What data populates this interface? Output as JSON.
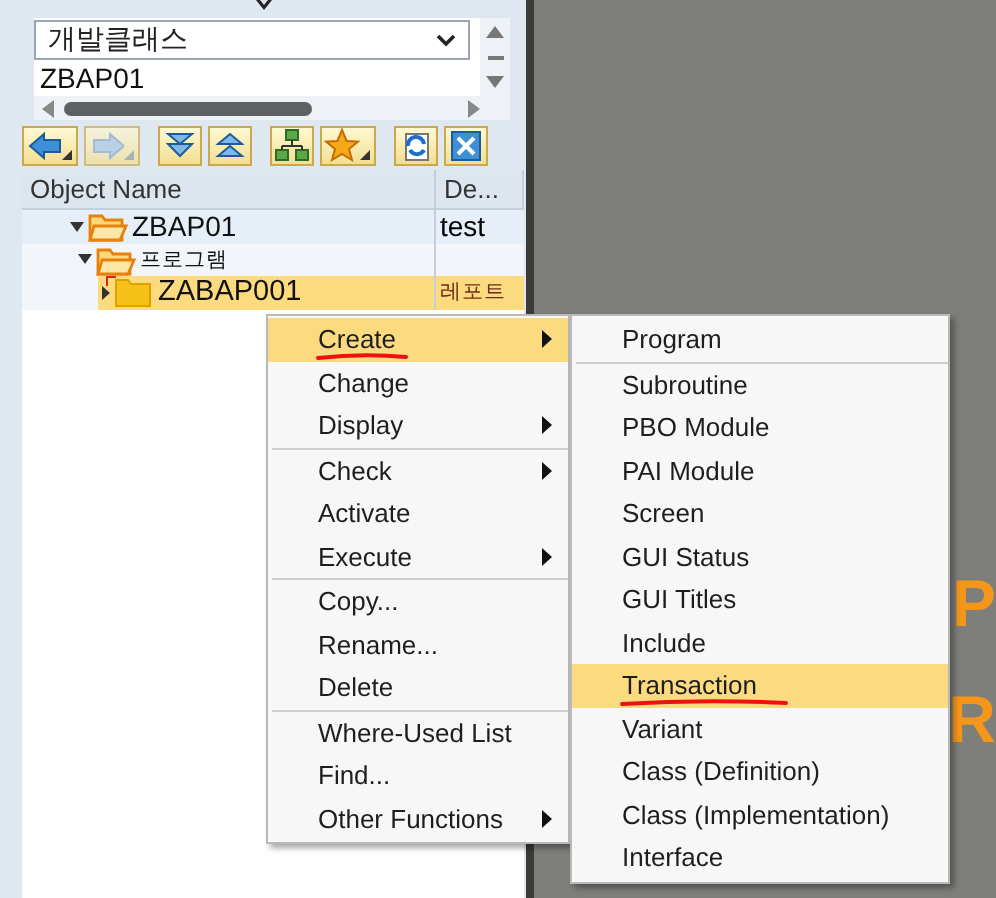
{
  "selector": {
    "value": "개발클래스"
  },
  "object_field": {
    "value": "ZBAP01"
  },
  "toolbar": [
    {
      "kind": "back",
      "dropdown": true,
      "disabled": false
    },
    {
      "kind": "forward",
      "dropdown": true,
      "disabled": true
    },
    {
      "kind": "expand",
      "dropdown": false,
      "disabled": false
    },
    {
      "kind": "collapse",
      "dropdown": false,
      "disabled": false
    },
    {
      "kind": "hierarchy",
      "dropdown": false,
      "disabled": false
    },
    {
      "kind": "favorite",
      "dropdown": true,
      "disabled": false
    },
    {
      "kind": "refresh",
      "dropdown": false,
      "disabled": false
    },
    {
      "kind": "close",
      "dropdown": false,
      "disabled": false
    }
  ],
  "tree": {
    "columns": [
      "Object Name",
      "De..."
    ],
    "rows": [
      {
        "name": "ZBAP01",
        "description": "test",
        "expanded": true,
        "selected": false,
        "children": [
          {
            "name": "프로그램",
            "expanded": true,
            "selected": false,
            "children": [
              {
                "name": "ZABAP001",
                "description": "레포트",
                "expanded": false,
                "selected": true
              }
            ]
          }
        ]
      }
    ]
  },
  "context_menu": {
    "groups": [
      [
        {
          "label": "Create",
          "submenu": true,
          "selected": true,
          "marked": true
        },
        {
          "label": "Change",
          "submenu": false,
          "selected": false,
          "marked": false
        },
        {
          "label": "Display",
          "submenu": true,
          "selected": false,
          "marked": false
        }
      ],
      [
        {
          "label": "Check",
          "submenu": true,
          "selected": false,
          "marked": false
        },
        {
          "label": "Activate",
          "submenu": false,
          "selected": false,
          "marked": false
        },
        {
          "label": "Execute",
          "submenu": true,
          "selected": false,
          "marked": false
        }
      ],
      [
        {
          "label": "Copy...",
          "submenu": false,
          "selected": false,
          "marked": false
        },
        {
          "label": "Rename...",
          "submenu": false,
          "selected": false,
          "marked": false
        },
        {
          "label": "Delete",
          "submenu": false,
          "selected": false,
          "marked": false
        }
      ],
      [
        {
          "label": "Where-Used List",
          "submenu": false,
          "selected": false,
          "marked": false
        },
        {
          "label": "Find...",
          "submenu": false,
          "selected": false,
          "marked": false
        },
        {
          "label": "Other Functions",
          "submenu": true,
          "selected": false,
          "marked": false
        }
      ]
    ]
  },
  "create_submenu": {
    "groups": [
      [
        {
          "label": "Program",
          "submenu": false,
          "selected": false,
          "marked": false
        }
      ],
      [
        {
          "label": "Subroutine",
          "submenu": false,
          "selected": false,
          "marked": false
        },
        {
          "label": "PBO Module",
          "submenu": false,
          "selected": false,
          "marked": false
        },
        {
          "label": "PAI Module",
          "submenu": false,
          "selected": false,
          "marked": false
        },
        {
          "label": "Screen",
          "submenu": false,
          "selected": false,
          "marked": false
        },
        {
          "label": "GUI Status",
          "submenu": false,
          "selected": false,
          "marked": false
        },
        {
          "label": "GUI Titles",
          "submenu": false,
          "selected": false,
          "marked": false
        },
        {
          "label": "Include",
          "submenu": false,
          "selected": false,
          "marked": false
        },
        {
          "label": "Transaction",
          "submenu": false,
          "selected": true,
          "marked": true
        },
        {
          "label": "Variant",
          "submenu": false,
          "selected": false,
          "marked": false
        },
        {
          "label": "Class (Definition)",
          "submenu": false,
          "selected": false,
          "marked": false
        },
        {
          "label": "Class (Implementation)",
          "submenu": false,
          "selected": false,
          "marked": false
        },
        {
          "label": "Interface",
          "submenu": false,
          "selected": false,
          "marked": false
        }
      ]
    ]
  },
  "background_letters": [
    "P",
    "R"
  ]
}
